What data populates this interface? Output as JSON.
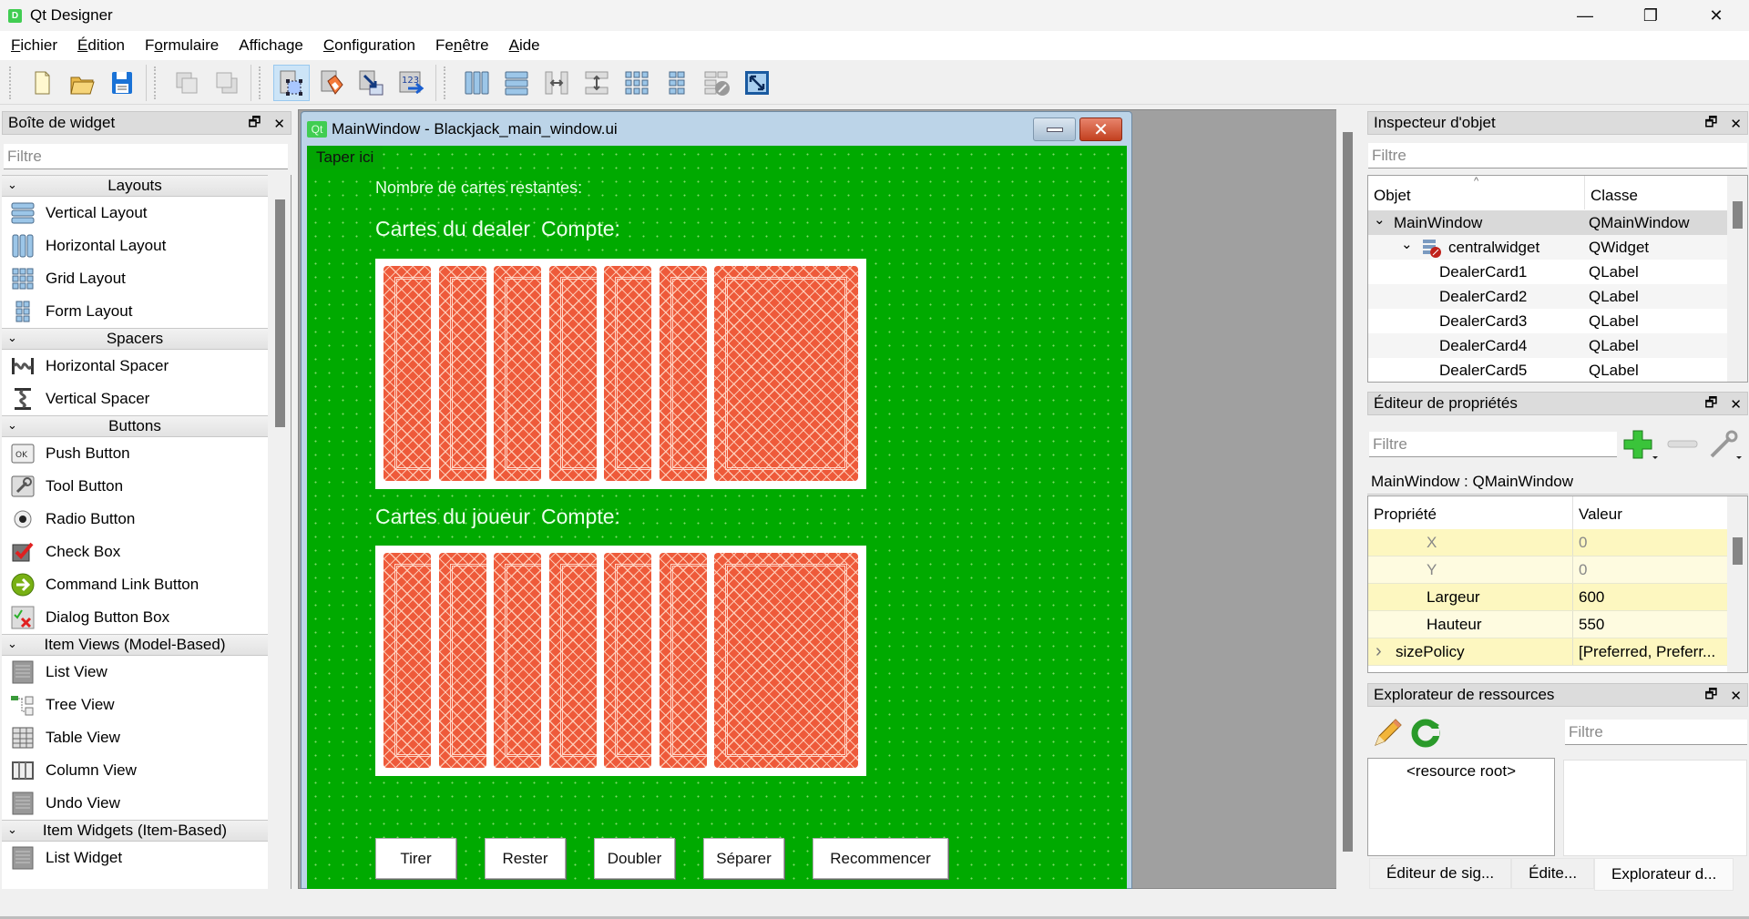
{
  "app": {
    "title": "Qt Designer",
    "icon_label": "D"
  },
  "window_controls": {
    "minimize": "—",
    "restore": "❐",
    "close": "✕"
  },
  "menubar": [
    {
      "label": "Fichier",
      "mnemonic": "F",
      "rest": "ichier"
    },
    {
      "label": "Édition",
      "mnemonic": "É",
      "rest": "dition"
    },
    {
      "label": "Formulaire",
      "pre": "F",
      "mnemonic": "o",
      "rest": "rmulaire"
    },
    {
      "label": "Affichage",
      "pre": "Afficha",
      "mnemonic": "g",
      "rest": "e"
    },
    {
      "label": "Configuration",
      "mnemonic": "C",
      "rest": "onfiguration"
    },
    {
      "label": "Fenêtre",
      "pre": "Fe",
      "mnemonic": "n",
      "rest": "être"
    },
    {
      "label": "Aide",
      "mnemonic": "A",
      "rest": "ide"
    }
  ],
  "toolbar": {
    "buttons": [
      "new-file",
      "open-file",
      "save-file",
      "send-to-back",
      "bring-to-front",
      "edit-widgets",
      "edit-signals-slots",
      "edit-buddies",
      "edit-tab-order",
      "lay-out-horizontally",
      "lay-out-vertically",
      "lay-out-horizontal-splitter",
      "lay-out-vertical-splitter",
      "lay-out-grid",
      "lay-out-form",
      "break-layout",
      "adjust-size"
    ],
    "active": "edit-widgets"
  },
  "widget_box": {
    "title": "Boîte de widget",
    "filter_placeholder": "Filtre",
    "categories": [
      {
        "name": "Layouts",
        "items": [
          {
            "label": "Vertical Layout",
            "icon": "vertical-layout"
          },
          {
            "label": "Horizontal Layout",
            "icon": "horizontal-layout"
          },
          {
            "label": "Grid Layout",
            "icon": "grid-layout"
          },
          {
            "label": "Form Layout",
            "icon": "form-layout"
          }
        ]
      },
      {
        "name": "Spacers",
        "items": [
          {
            "label": "Horizontal Spacer",
            "icon": "horizontal-spacer"
          },
          {
            "label": "Vertical Spacer",
            "icon": "vertical-spacer"
          }
        ]
      },
      {
        "name": "Buttons",
        "items": [
          {
            "label": "Push Button",
            "icon": "push-button"
          },
          {
            "label": "Tool Button",
            "icon": "tool-button"
          },
          {
            "label": "Radio Button",
            "icon": "radio-button"
          },
          {
            "label": "Check Box",
            "icon": "check-box"
          },
          {
            "label": "Command Link Button",
            "icon": "command-link"
          },
          {
            "label": "Dialog Button Box",
            "icon": "dialog-button-box"
          }
        ]
      },
      {
        "name": "Item Views (Model-Based)",
        "items": [
          {
            "label": "List View",
            "icon": "list-view"
          },
          {
            "label": "Tree View",
            "icon": "tree-view"
          },
          {
            "label": "Table View",
            "icon": "table-view"
          },
          {
            "label": "Column View",
            "icon": "column-view"
          },
          {
            "label": "Undo View",
            "icon": "undo-view"
          }
        ]
      },
      {
        "name": "Item Widgets (Item-Based)",
        "items": [
          {
            "label": "List Widget",
            "icon": "list-widget"
          }
        ]
      }
    ]
  },
  "form": {
    "window_title": "MainWindow - Blackjack_main_window.ui",
    "qt_badge": "Qt",
    "menu_placeholder": "Taper ici",
    "remaining_label": "Nombre de cartes restantes:",
    "dealer_label": "Cartes du dealer",
    "dealer_count_label": "Compte:",
    "player_label": "Cartes du joueur",
    "player_count_label": "Compte:",
    "dealer_cards": 7,
    "player_cards": 7,
    "buttons": [
      "Tirer",
      "Rester",
      "Doubler",
      "Séparer",
      "Recommencer"
    ],
    "colors": {
      "background": "#00aa00",
      "card_back": "#ee5a3a"
    }
  },
  "object_inspector": {
    "title": "Inspecteur d'objet",
    "filter_placeholder": "Filtre",
    "columns": [
      "Objet",
      "Classe"
    ],
    "rows": [
      {
        "object": "MainWindow",
        "class": "QMainWindow",
        "level": 0,
        "expanded": true,
        "selected": true
      },
      {
        "object": "centralwidget",
        "class": "QWidget",
        "level": 1,
        "expanded": true,
        "icon": "widget-broken-layout"
      },
      {
        "object": "DealerCard1",
        "class": "QLabel",
        "level": 2
      },
      {
        "object": "DealerCard2",
        "class": "QLabel",
        "level": 2
      },
      {
        "object": "DealerCard3",
        "class": "QLabel",
        "level": 2
      },
      {
        "object": "DealerCard4",
        "class": "QLabel",
        "level": 2
      },
      {
        "object": "DealerCard5",
        "class": "QLabel",
        "level": 2
      }
    ]
  },
  "property_editor": {
    "title": "Éditeur de propriétés",
    "filter_placeholder": "Filtre",
    "object_label": "MainWindow : QMainWindow",
    "columns": [
      "Propriété",
      "Valeur"
    ],
    "rows": [
      {
        "name": "X",
        "value": "0",
        "dim": true,
        "shade": "y1"
      },
      {
        "name": "Y",
        "value": "0",
        "dim": true,
        "shade": "y2"
      },
      {
        "name": "Largeur",
        "value": "600",
        "dim": false,
        "shade": "y1"
      },
      {
        "name": "Hauteur",
        "value": "550",
        "dim": false,
        "shade": "y2"
      },
      {
        "name": "sizePolicy",
        "value": "[Preferred, Preferr...",
        "dim": false,
        "shade": "y1",
        "expandable": true
      }
    ]
  },
  "resource_browser": {
    "title": "Explorateur de ressources",
    "filter_placeholder": "Filtre",
    "root": "<resource root>"
  },
  "bottom_tabs": [
    {
      "label": "Éditeur de sig...",
      "active": false
    },
    {
      "label": "Édite...",
      "active": false
    },
    {
      "label": "Explorateur d...",
      "active": true
    }
  ]
}
